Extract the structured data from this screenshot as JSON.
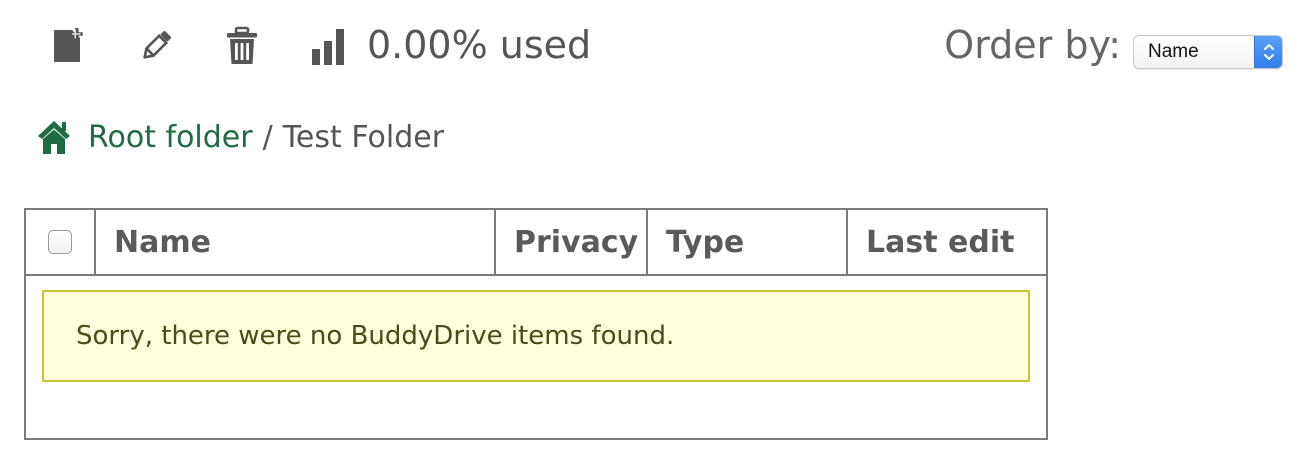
{
  "toolbar": {
    "add_icon": "new-file-icon",
    "edit_icon": "pencil-icon",
    "delete_icon": "trash-icon",
    "quota_icon": "bar-chart-icon",
    "quota_text": "0.00% used",
    "order_label": "Order by:",
    "order_select_value": "Name"
  },
  "breadcrumb": {
    "home_icon": "home-icon",
    "root_label": "Root folder",
    "separator": "/",
    "current_label": "Test Folder"
  },
  "table": {
    "columns": {
      "name": "Name",
      "privacy": "Privacy",
      "type": "Type",
      "last_edit": "Last edit"
    },
    "empty_message": "Sorry, there were no BuddyDrive items found."
  },
  "colors": {
    "link_green": "#1f6b44",
    "notice_bg": "#ffffdc",
    "notice_border": "#cbc534",
    "select_blue": "#3b88f0"
  }
}
